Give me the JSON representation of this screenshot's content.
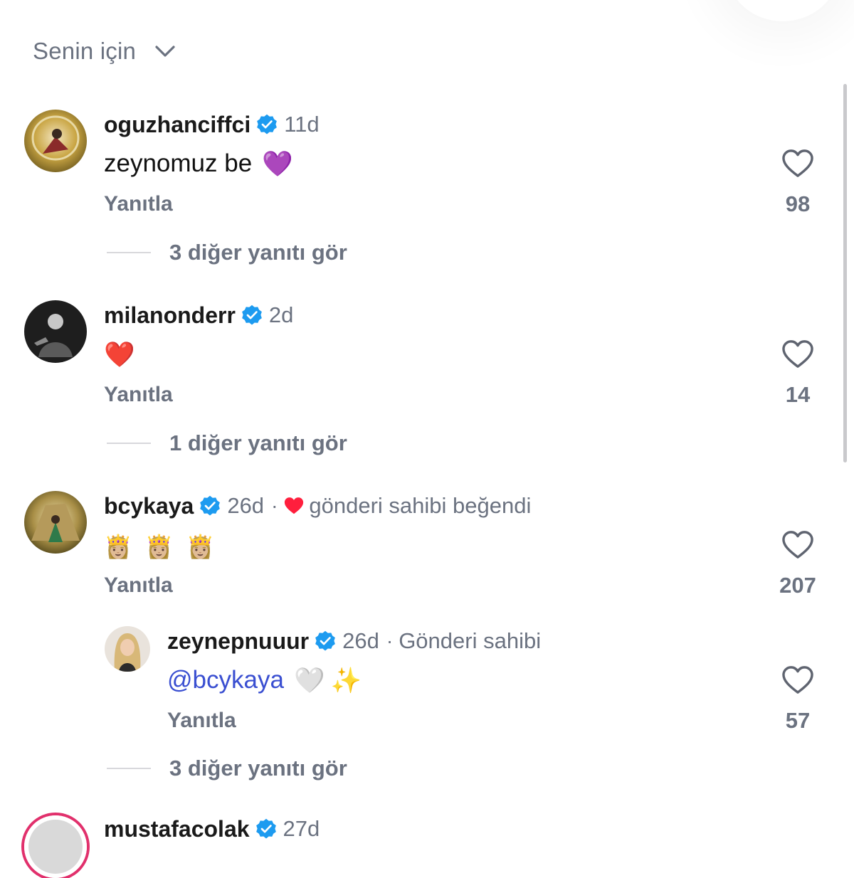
{
  "header": {
    "filter_label": "Senin için"
  },
  "comments": [
    {
      "username": "oguzhanciffci",
      "time": "11d",
      "text": "zeynomuz be",
      "emoji": "💜",
      "reply_label": "Yanıtla",
      "likes": "98",
      "more_replies": "3 diğer yanıtı gör"
    },
    {
      "username": "milanonderr",
      "time": "2d",
      "emoji": "❤️",
      "reply_label": "Yanıtla",
      "likes": "14",
      "more_replies": "1 diğer yanıtı gör"
    },
    {
      "username": "bcykaya",
      "time": "26d",
      "separator": "·",
      "owner_liked": "gönderi sahibi beğendi",
      "emojis": [
        "👸🏼",
        "👸🏼",
        "👸🏼"
      ],
      "reply_label": "Yanıtla",
      "likes": "207",
      "reply": {
        "username": "zeynepnuuur",
        "time": "26d",
        "separator": "·",
        "role": "Gönderi sahibi",
        "mention": "@bcykaya",
        "emojis": [
          "🤍",
          "✨"
        ],
        "reply_label": "Yanıtla",
        "likes": "57"
      },
      "more_replies": "3 diğer yanıtı gör"
    },
    {
      "username": "mustafacolak",
      "time": "27d"
    }
  ],
  "colors": {
    "verified": "#1d9bf0",
    "mention": "#3a4fd1",
    "muted": "#6b7280",
    "owner_heart": "#ff1f3d"
  }
}
